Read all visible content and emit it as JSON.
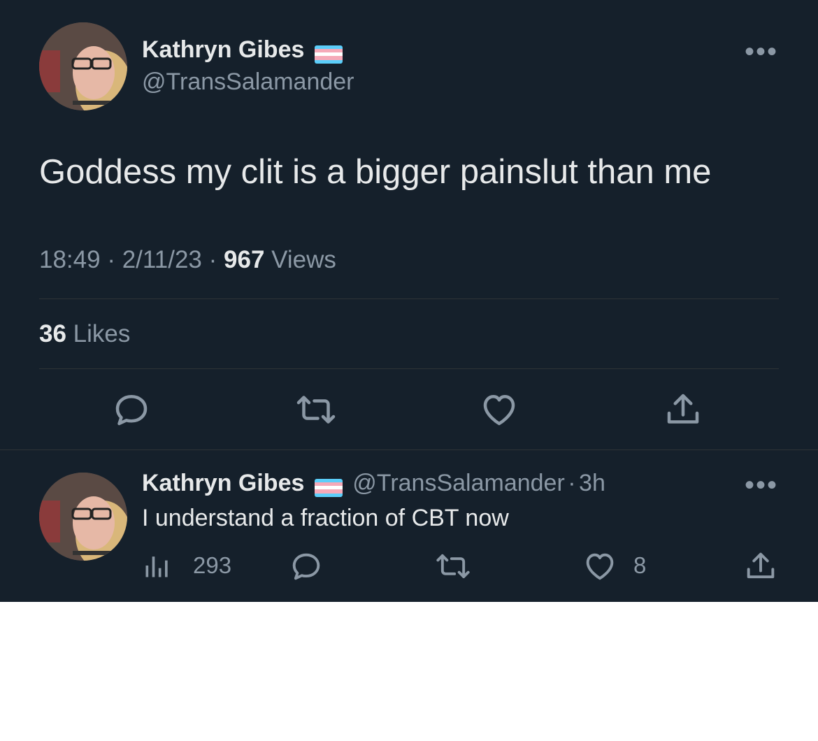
{
  "main_tweet": {
    "author_name": "Kathryn Gibes",
    "author_handle": "@TransSalamander",
    "text": "Goddess my clit is a bigger painslut than me",
    "time": "18:49",
    "date": "2/11/23",
    "views_count": "967",
    "views_label": "Views",
    "likes_count": "36",
    "likes_label": "Likes",
    "separator": "·"
  },
  "reply": {
    "author_name": "Kathryn Gibes",
    "author_handle": "@TransSalamander",
    "time_ago": "3h",
    "text": "I understand a fraction of CBT now",
    "views": "293",
    "likes": "8"
  },
  "more_label": "•••",
  "flag_colors": [
    "#5bcefa",
    "#f5a9b8",
    "#ffffff",
    "#f5a9b8",
    "#5bcefa"
  ],
  "icons": [
    "more-icon",
    "reply-icon",
    "retweet-icon",
    "like-icon",
    "share-icon",
    "views-icon"
  ],
  "colors": {
    "background": "#15202b",
    "text": "#e7e9ea",
    "muted": "#8b98a5",
    "divider": "#2f3336"
  }
}
